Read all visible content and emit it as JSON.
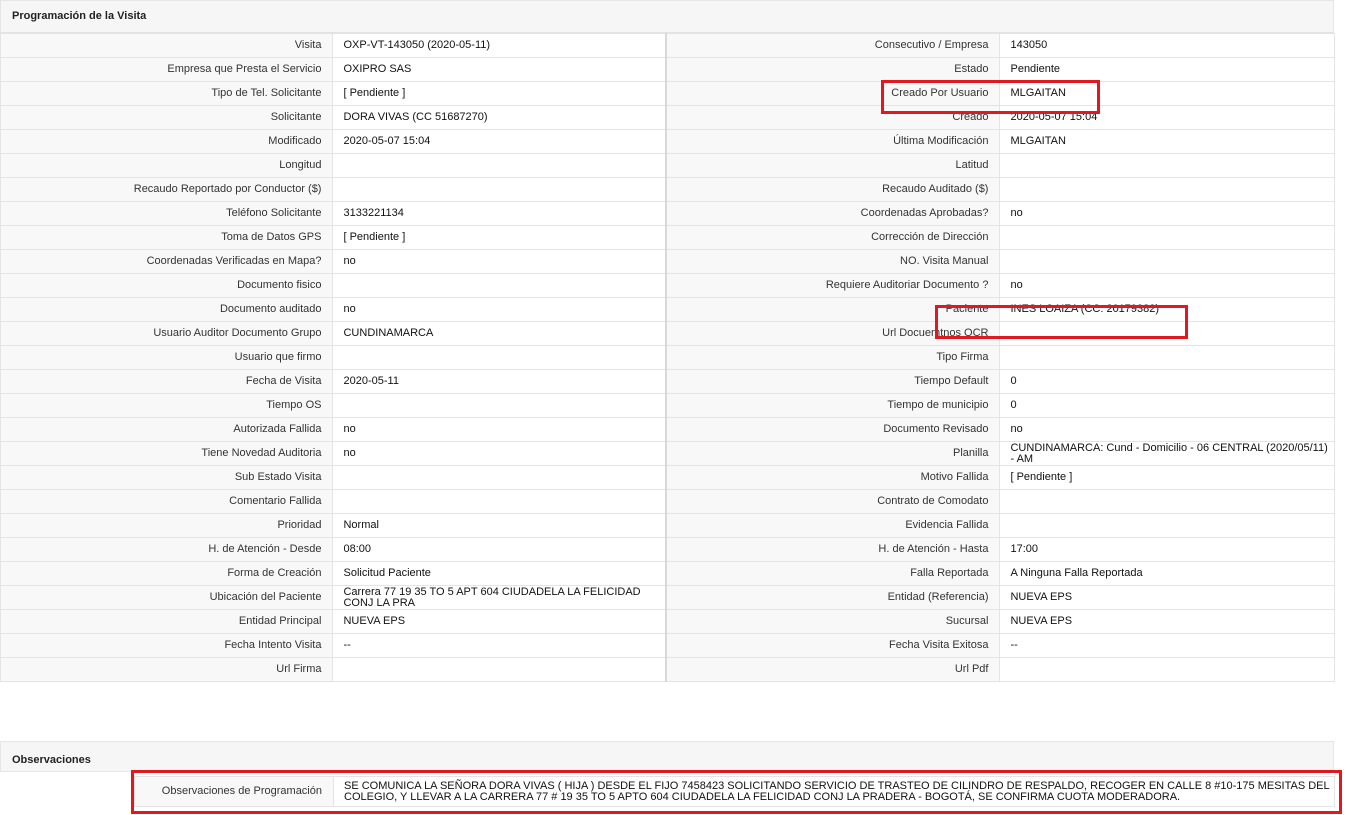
{
  "section_title": "Programación de la Visita",
  "rows": [
    {
      "l1": "Visita",
      "v1": "OXP-VT-143050 (2020-05-11)",
      "l2": "Consecutivo / Empresa",
      "v2": "143050"
    },
    {
      "l1": "Empresa que Presta el Servicio",
      "v1": "OXIPRO SAS",
      "l2": "Estado",
      "v2": "Pendiente"
    },
    {
      "l1": "Tipo de Tel. Solicitante",
      "v1": "[ Pendiente ]",
      "l2": "Creado Por Usuario",
      "v2": "MLGAITAN"
    },
    {
      "l1": "Solicitante",
      "v1": "DORA VIVAS (CC 51687270)",
      "l2": "Creado",
      "v2": "2020-05-07 15:04"
    },
    {
      "l1": "Modificado",
      "v1": "2020-05-07 15:04",
      "l2": "Última Modificación",
      "v2": " MLGAITAN"
    },
    {
      "l1": "Longitud",
      "v1": "",
      "l2": "Latitud",
      "v2": ""
    },
    {
      "l1": "Recaudo Reportado por Conductor ($)",
      "v1": "",
      "l2": "Recaudo Auditado ($)",
      "v2": ""
    },
    {
      "l1": "Teléfono Solicitante",
      "v1": "3133221134",
      "l2": "Coordenadas Aprobadas?",
      "v2": " no"
    },
    {
      "l1": "Toma de Datos GPS",
      "v1": "[ Pendiente ]",
      "l2": "Corrección de Dirección",
      "v2": ""
    },
    {
      "l1": "Coordenadas Verificadas en Mapa?",
      "v1": " no",
      "l2": "NO. Visita Manual",
      "v2": ""
    },
    {
      "l1": "Documento fisico",
      "v1": "",
      "l2": "Requiere Auditoriar Documento ?",
      "v2": " no"
    },
    {
      "l1": "Documento auditado",
      "v1": " no",
      "l2": "Paciente",
      "v2": "INES LOAIZA (CC: 20179382)"
    },
    {
      "l1": "Usuario Auditor Documento Grupo",
      "v1": "CUNDINAMARCA",
      "l2": "Url Docuemtnos OCR",
      "v2": ""
    },
    {
      "l1": "Usuario que firmo",
      "v1": "",
      "l2": "Tipo Firma",
      "v2": ""
    },
    {
      "l1": "Fecha de Visita",
      "v1": " 2020-05-11",
      "l2": "Tiempo Default",
      "v2": "0"
    },
    {
      "l1": "Tiempo OS",
      "v1": "",
      "l2": "Tiempo de municipio",
      "v2": "0"
    },
    {
      "l1": "Autorizada Fallida",
      "v1": " no",
      "l2": "Documento Revisado",
      "v2": " no"
    },
    {
      "l1": "Tiene Novedad Auditoria",
      "v1": " no",
      "l2": "Planilla",
      "v2": "CUNDINAMARCA: Cund - Domicilio - 06 CENTRAL (2020/05/11) - AM"
    },
    {
      "l1": "Sub Estado Visita",
      "v1": "",
      "l2": "Motivo Fallida",
      "v2": "[ Pendiente ]"
    },
    {
      "l1": "Comentario Fallida",
      "v1": "",
      "l2": "Contrato de Comodato",
      "v2": ""
    },
    {
      "l1": "Prioridad",
      "v1": "Normal",
      "l2": "Evidencia Fallida",
      "v2": ""
    },
    {
      "l1": "H. de Atención - Desde",
      "v1": "08:00",
      "l2": "H. de Atención - Hasta",
      "v2": "17:00"
    },
    {
      "l1": "Forma de Creación",
      "v1": "Solicitud Paciente",
      "l2": "Falla Reportada",
      "v2": "A Ninguna Falla Reportada"
    },
    {
      "l1": "Ubicación del Paciente",
      "v1": "Carrera 77 19 35 TO 5 APT 604 CIUDADELA LA FELICIDAD CONJ LA PRA",
      "l2": "Entidad (Referencia)",
      "v2": "NUEVA EPS"
    },
    {
      "l1": "Entidad Principal",
      "v1": "NUEVA EPS",
      "l2": "Sucursal",
      "v2": "NUEVA EPS"
    },
    {
      "l1": "Fecha Intento Visita",
      "v1": " --",
      "l2": "Fecha Visita Exitosa",
      "v2": " --"
    },
    {
      "l1": "Url Firma",
      "v1": "",
      "l2": "Url Pdf",
      "v2": ""
    }
  ],
  "observations": {
    "title": "Observaciones",
    "label": "Observaciones de Programación",
    "value": " SE COMUNICA LA SEÑORA DORA VIVAS ( HIJA ) DESDE EL FIJO 7458423 SOLICITANDO SERVICIO DE TRASTEO DE CILINDRO DE RESPALDO, RECOGER EN CALLE 8 #10-175 MESITAS DEL COLEGIO, Y LLEVAR A LA CARRERA 77 # 19 35 TO 5 APTO 604 CIUDADELA LA FELICIDAD CONJ LA PRADERA - BOGOTÁ, SE CONFIRMA CUOTA MODERADORA."
  },
  "colors": {
    "highlight": "#e01820",
    "label_bg": "#f8f8f8",
    "border": "#e4e4e4"
  }
}
